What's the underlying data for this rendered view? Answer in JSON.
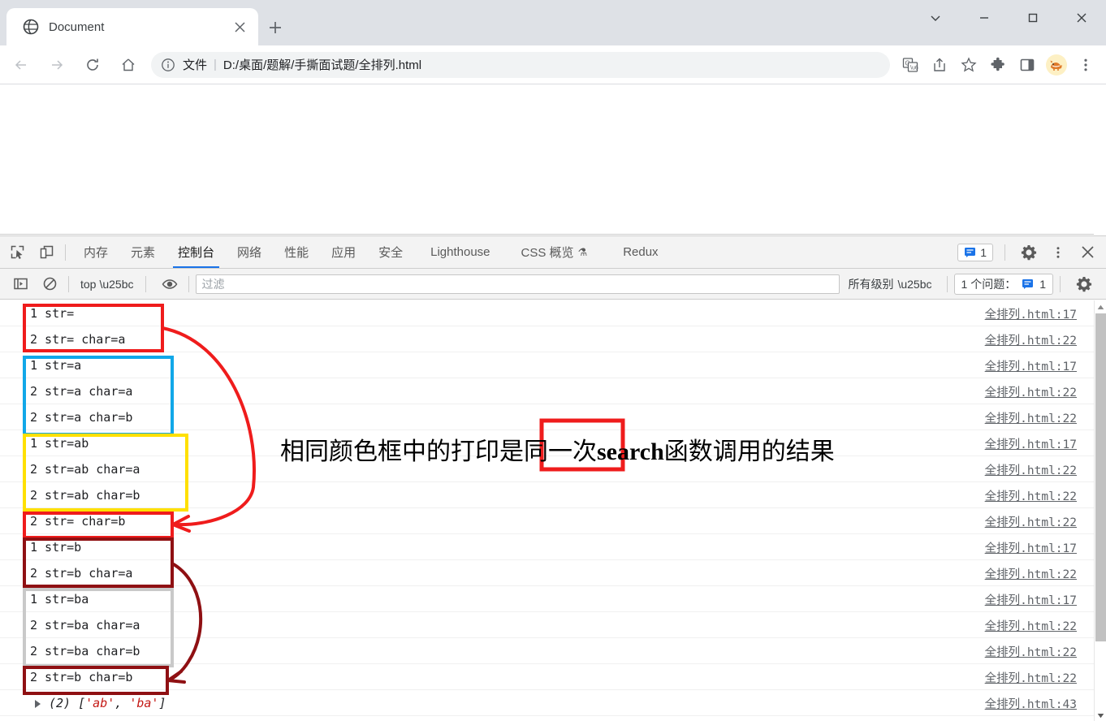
{
  "browser": {
    "tab": {
      "title": "Document",
      "favicon": "globe-icon",
      "close": "×"
    },
    "new_tab_label": "+",
    "window_controls": {
      "minimize": "—",
      "maximize": "□",
      "close": "✕",
      "chevron": "⌄"
    },
    "toolbar": {
      "back": "←",
      "forward": "→",
      "reload": "↻",
      "home": "⌂",
      "omnibox": {
        "info_icon": "info-circle-icon",
        "scheme_label": "文件",
        "separator": "|",
        "url": "D:/桌面/题解/手撕面试题/全排列.html"
      },
      "actions": [
        "translate-icon",
        "share-icon",
        "bookmark-star-icon",
        "extensions-puzzle-icon",
        "side-panel-icon",
        "profile-avatar-icon",
        "more-menu-icon"
      ],
      "avatar_glyph": "🐕"
    }
  },
  "devtools": {
    "left_controls": [
      "inspect-element-icon",
      "device-toolbar-icon"
    ],
    "tabs": [
      {
        "label": "内存",
        "active": false
      },
      {
        "label": "元素",
        "active": false
      },
      {
        "label": "控制台",
        "active": true
      },
      {
        "label": "网络",
        "active": false
      },
      {
        "label": "性能",
        "active": false
      },
      {
        "label": "应用",
        "active": false
      },
      {
        "label": "安全",
        "active": false
      },
      {
        "label": "Lighthouse",
        "active": false
      },
      {
        "label": "CSS 概览",
        "active": false,
        "badge": "⚗"
      },
      {
        "label": "Redux",
        "active": false
      }
    ],
    "issues_chip_count": "1",
    "right_controls": [
      "settings-gear-icon",
      "more-vertical-icon",
      "close-devtools-icon"
    ],
    "console_toolbar": {
      "sidebar_toggle": "console-sidebar-icon",
      "clear": "clear-console-icon",
      "context": "top",
      "eye": "live-expression-icon",
      "filter_placeholder": "过滤",
      "filter_value": "",
      "level_label": "所有级别",
      "issues_label": "1 个问题：",
      "issues_count": "1",
      "settings": "console-settings-gear-icon"
    }
  },
  "console_log": [
    {
      "message": "1 str=",
      "source": "全排列.html:17"
    },
    {
      "message": "2 str= char=a",
      "source": "全排列.html:22"
    },
    {
      "message": "1 str=a",
      "source": "全排列.html:17"
    },
    {
      "message": "2 str=a char=a",
      "source": "全排列.html:22"
    },
    {
      "message": "2 str=a char=b",
      "source": "全排列.html:22"
    },
    {
      "message": "1 str=ab",
      "source": "全排列.html:17"
    },
    {
      "message": "2 str=ab char=a",
      "source": "全排列.html:22"
    },
    {
      "message": "2 str=ab char=b",
      "source": "全排列.html:22"
    },
    {
      "message": "2 str= char=b",
      "source": "全排列.html:22"
    },
    {
      "message": "1 str=b",
      "source": "全排列.html:17"
    },
    {
      "message": "2 str=b char=a",
      "source": "全排列.html:22"
    },
    {
      "message": "1 str=ba",
      "source": "全排列.html:17"
    },
    {
      "message": "2 str=ba char=a",
      "source": "全排列.html:22"
    },
    {
      "message": "2 str=ba char=b",
      "source": "全排列.html:22"
    },
    {
      "message": "2 str=b char=b",
      "source": "全排列.html:22"
    }
  ],
  "console_result": {
    "expander": "▶",
    "count_label": "(2)",
    "open_bracket": "[",
    "items": [
      "'ab'",
      "'ba'"
    ],
    "comma": ",",
    "close_bracket": "]",
    "source": "全排列.html:43"
  },
  "annotation": {
    "text_prefix": "相同颜色框中的打印是同一次",
    "text_bold": "search",
    "text_suffix": "函数调用的结果",
    "colors": {
      "red": "#ef1c1c",
      "blue": "#11a7e8",
      "yellow": "#ffe000",
      "dark_red": "#8f1013",
      "gray": "#c9c9c9"
    },
    "boxes": [
      {
        "color_key": "red",
        "rows": "1-2",
        "note": "str= group"
      },
      {
        "color_key": "blue",
        "rows": "3-5",
        "note": "str=a group"
      },
      {
        "color_key": "yellow",
        "rows": "6-8",
        "note": "str=ab group"
      },
      {
        "color_key": "red",
        "rows": "9",
        "note": "str= char=b"
      },
      {
        "color_key": "dark_red",
        "rows": "10-11",
        "note": "str=b group"
      },
      {
        "color_key": "gray",
        "rows": "12-14",
        "note": "str=ba group"
      },
      {
        "color_key": "dark_red",
        "rows": "15",
        "note": "str=b char=b"
      }
    ]
  }
}
